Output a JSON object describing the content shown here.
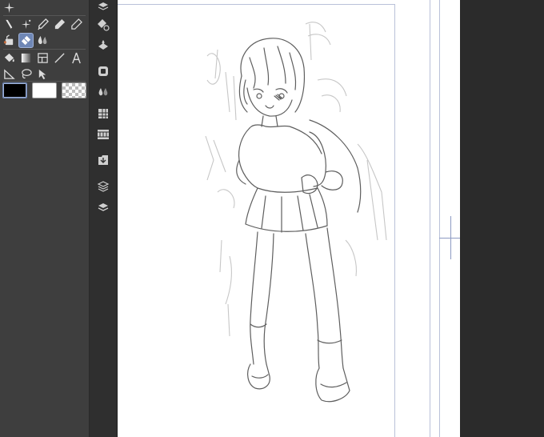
{
  "tool_panel": {
    "title_icon": "sparkle-icon",
    "tool_rows": [
      [
        "pen-tool-icon",
        "sparkle-pencil-icon",
        "marker-icon",
        "ink-pen-icon",
        "fountain-pen-icon"
      ],
      [
        "fill-bucket-tool-icon",
        "eraser-icon",
        "blend-drop-icon"
      ],
      [
        "paint-bucket-icon",
        "gradient-icon",
        "frame-border-icon",
        "line-icon",
        "text-tool-icon"
      ],
      [
        "polyline-icon",
        "lasso-icon",
        "select-arrow-icon"
      ]
    ],
    "active_tool": "eraser-icon"
  },
  "colors": {
    "main_color": "#000000",
    "sub_color": "#ffffff",
    "transparent": "checker",
    "accent": "#6f87b6",
    "guide": "#b9c1d9",
    "panel_bg": "#3e3e3e",
    "command_bar_bg": "#2f2f2f"
  },
  "command_bar": {
    "items": [
      "layer-settings-icon",
      "erase-selection-icon",
      "fill-layer-icon",
      "reference-layer-icon",
      "transparency-icon",
      "grid-icon",
      "timeline-icon",
      "export-icon",
      "layer-stack-settings-icon",
      "layers-icon"
    ]
  },
  "canvas": {
    "content": "pencil-sketch-of-girl",
    "background": "#ffffff"
  }
}
